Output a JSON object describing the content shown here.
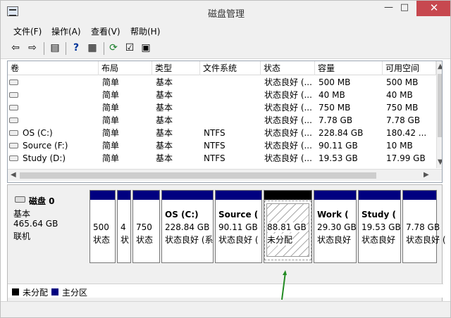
{
  "window": {
    "title": "磁盘管理",
    "min": "—",
    "max": "□",
    "close": "✕"
  },
  "menu": [
    "文件(F)",
    "操作(A)",
    "查看(V)",
    "帮助(H)"
  ],
  "toolbar": {
    "icons": [
      "back-arrow-icon",
      "forward-arrow-icon",
      "view-icon",
      "help-icon",
      "details-icon",
      "refresh-icon",
      "properties-icon",
      "export-icon"
    ]
  },
  "table": {
    "columns": [
      "卷",
      "布局",
      "类型",
      "文件系统",
      "状态",
      "容量",
      "可用空间"
    ],
    "rows": [
      {
        "volume": "",
        "layout": "简单",
        "type": "基本",
        "fs": "",
        "status": "状态良好 (...",
        "capacity": "500 MB",
        "free": "500 MB"
      },
      {
        "volume": "",
        "layout": "简单",
        "type": "基本",
        "fs": "",
        "status": "状态良好 (...",
        "capacity": "40 MB",
        "free": "40 MB"
      },
      {
        "volume": "",
        "layout": "简单",
        "type": "基本",
        "fs": "",
        "status": "状态良好 (...",
        "capacity": "750 MB",
        "free": "750 MB"
      },
      {
        "volume": "",
        "layout": "简单",
        "type": "基本",
        "fs": "",
        "status": "状态良好 (...",
        "capacity": "7.78 GB",
        "free": "7.78 GB"
      },
      {
        "volume": "OS (C:)",
        "layout": "简单",
        "type": "基本",
        "fs": "NTFS",
        "status": "状态良好 (...",
        "capacity": "228.84 GB",
        "free": "180.42 ..."
      },
      {
        "volume": "Source (F:)",
        "layout": "简单",
        "type": "基本",
        "fs": "NTFS",
        "status": "状态良好 (...",
        "capacity": "90.11 GB",
        "free": "10 MB"
      },
      {
        "volume": "Study (D:)",
        "layout": "简单",
        "type": "基本",
        "fs": "NTFS",
        "status": "状态良好 (...",
        "capacity": "19.53 GB",
        "free": "17.99 GB"
      }
    ]
  },
  "disk": {
    "name": "磁盘 0",
    "type": "基本",
    "size": "465.64 GB",
    "state": "联机"
  },
  "partitions": [
    {
      "title": "",
      "size": "500",
      "status": "状态",
      "unallocated": false
    },
    {
      "title": "",
      "size": "4",
      "status": "状",
      "unallocated": false
    },
    {
      "title": "",
      "size": "750",
      "status": "状态",
      "unallocated": false
    },
    {
      "title": "OS  (C:)",
      "size": "228.84 GB",
      "status": "状态良好 (系",
      "unallocated": false
    },
    {
      "title": "Source  (",
      "size": "90.11 GB",
      "status": "状态良好 (",
      "unallocated": false
    },
    {
      "title": "",
      "size": "88.81 GB",
      "status": "未分配",
      "unallocated": true
    },
    {
      "title": "Work  (",
      "size": "29.30 GB",
      "status": "状态良好",
      "unallocated": false
    },
    {
      "title": "Study  (",
      "size": "19.53 GB",
      "status": "状态良好",
      "unallocated": false
    },
    {
      "title": "",
      "size": "7.78 GB",
      "status": "状态良好 (",
      "unallocated": false
    }
  ],
  "legend": {
    "unallocated": "未分配",
    "primary": "主分区",
    "unallocated_color": "#000000",
    "primary_color": "#000080"
  },
  "colors": {
    "annotation_arrow": "#228b22"
  }
}
